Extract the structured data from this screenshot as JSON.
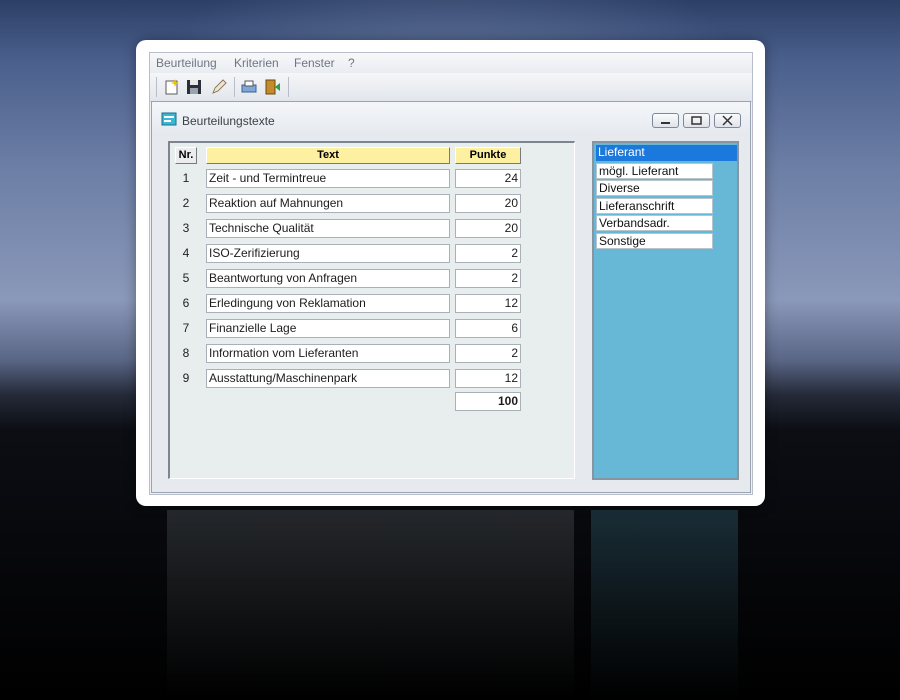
{
  "menu": [
    "Beurteilung",
    "Kriterien",
    "Fenster",
    "?"
  ],
  "toolbar_icons": [
    "new-icon",
    "save-icon",
    "edit-icon",
    "print-icon",
    "exit-icon"
  ],
  "window": {
    "title": "Beurteilungstexte",
    "icon": "window-icon"
  },
  "table": {
    "headers": {
      "nr": "Nr.",
      "text": "Text",
      "points": "Punkte"
    },
    "rows": [
      {
        "nr": "1",
        "text": "Zeit - und Termintreue",
        "points": "24"
      },
      {
        "nr": "2",
        "text": "Reaktion auf Mahnungen",
        "points": "20"
      },
      {
        "nr": "3",
        "text": "Technische Qualität",
        "points": "20"
      },
      {
        "nr": "4",
        "text": "ISO-Zerifizierung",
        "points": "2"
      },
      {
        "nr": "5",
        "text": "Beantwortung von Anfragen",
        "points": "2"
      },
      {
        "nr": "6",
        "text": "Erledingung von Reklamation",
        "points": "12"
      },
      {
        "nr": "7",
        "text": "Finanzielle Lage",
        "points": "6"
      },
      {
        "nr": "8",
        "text": "Information vom Lieferanten",
        "points": "2"
      },
      {
        "nr": "9",
        "text": "Ausstattung/Maschinenpark",
        "points": "12"
      }
    ],
    "total": "100"
  },
  "categories": {
    "items": [
      "Lieferant",
      "mögl. Lieferant",
      "Diverse",
      "Lieferanschrift",
      "Verbandsadr.",
      "Sonstige"
    ],
    "selected": "Lieferant"
  },
  "colors": {
    "header_yellow": "#fdf0a0",
    "list_background": "#67b7d6",
    "selection_blue": "#1b79de"
  }
}
